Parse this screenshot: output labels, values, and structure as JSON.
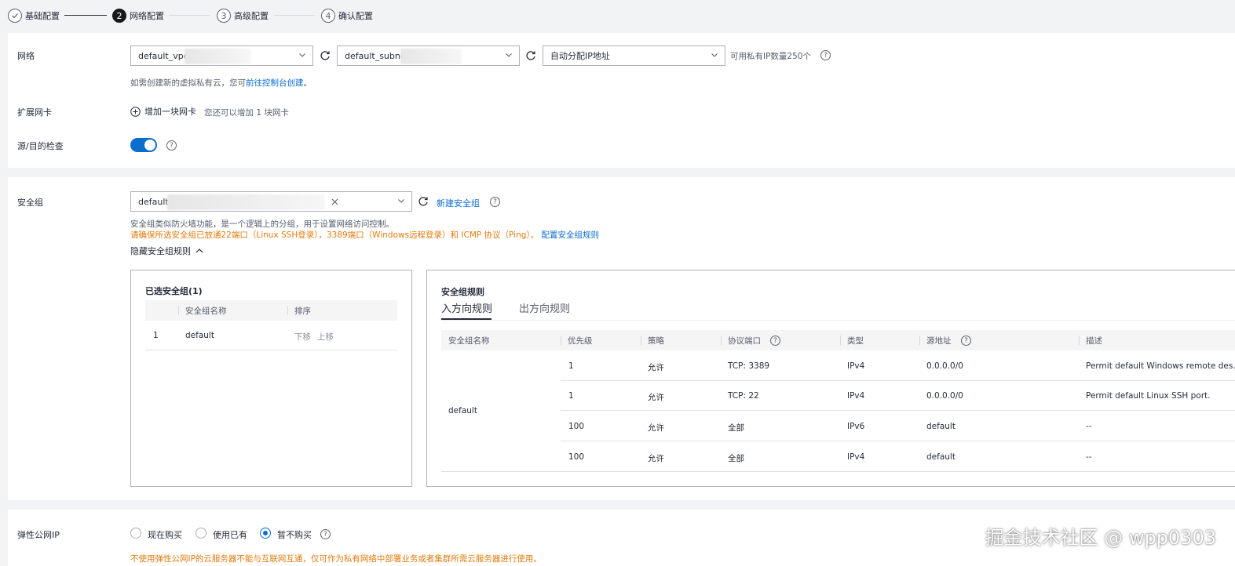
{
  "steps": [
    {
      "num": "✓",
      "label": "基础配置",
      "state": "done"
    },
    {
      "num": "2",
      "label": "网络配置",
      "state": "active"
    },
    {
      "num": "3",
      "label": "高级配置",
      "state": "pending"
    },
    {
      "num": "4",
      "label": "确认配置",
      "state": "pending"
    }
  ],
  "network": {
    "label": "网络",
    "vpc_value": "default_vpc",
    "subnet_value": "default_subne",
    "ip_value": "自动分配IP地址",
    "available_ip": "可用私有IP数量250个",
    "hint_prefix": "如需创建新的虚拟私有云，您可",
    "hint_link": "前往控制台创建",
    "hint_suffix": "。"
  },
  "ext_nic": {
    "label": "扩展网卡",
    "add_label": "增加一块网卡",
    "hint": "您还可以增加 1 块网卡"
  },
  "src_dst_check": {
    "label": "源/目的检查",
    "enabled": true
  },
  "security_group": {
    "label": "安全组",
    "value": "default(",
    "new_link": "新建安全组",
    "hint": "安全组类似防火墙功能，是一个逻辑上的分组，用于设置网络访问控制。",
    "warn": "请确保所选安全组已放通22端口（Linux SSH登录），3389端口（Windows远程登录）和 ICMP 协议（Ping）。",
    "config_link": "配置安全组规则",
    "collapse_label": "隐藏安全组规则"
  },
  "selected_groups": {
    "title": "已选安全组(1)",
    "headers": [
      "安全组名称",
      "排序"
    ],
    "rows": [
      {
        "index": "1",
        "name": "default",
        "down": "下移",
        "up": "上移"
      }
    ]
  },
  "rules": {
    "title": "安全组规则",
    "tabs": [
      "入方向规则",
      "出方向规则"
    ],
    "headers": [
      "安全组名称",
      "优先级",
      "策略",
      "协议端口",
      "类型",
      "源地址",
      "描述"
    ],
    "group_name": "default",
    "rows": [
      {
        "priority": "1",
        "action": "允许",
        "port": "TCP: 3389",
        "type": "IPv4",
        "source": "0.0.0.0/0",
        "source_link": false,
        "desc": "Permit default Windows remote des…"
      },
      {
        "priority": "1",
        "action": "允许",
        "port": "TCP: 22",
        "type": "IPv4",
        "source": "0.0.0.0/0",
        "source_link": false,
        "desc": "Permit default Linux SSH port."
      },
      {
        "priority": "100",
        "action": "允许",
        "port": "全部",
        "type": "IPv6",
        "source": "default",
        "source_link": true,
        "desc": "--"
      },
      {
        "priority": "100",
        "action": "允许",
        "port": "全部",
        "type": "IPv4",
        "source": "default",
        "source_link": true,
        "desc": "--"
      }
    ]
  },
  "eip": {
    "label": "弹性公网IP",
    "options": [
      "现在购买",
      "使用已有",
      "暂不购买"
    ],
    "selected": "暂不购买",
    "warn": "不使用弹性公网IP的云服务器不能与互联网互通，仅可作为私有网络中部署业务或者集群所需云服务器进行使用。"
  },
  "watermark": "掘金技术社区 @ wpp0303",
  "colors": {
    "accent": "#0a6ed1",
    "warning": "#e37b0d",
    "border": "#adb0b8"
  }
}
